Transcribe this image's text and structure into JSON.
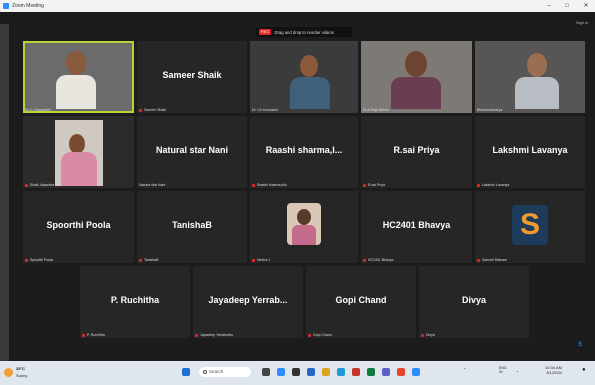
{
  "window": {
    "title": "Zoom Meeting",
    "minimize": "–",
    "maximize": "□",
    "close": "✕"
  },
  "banner": {
    "tag": "REC",
    "message": "Drag and drop to reorder videos"
  },
  "signin": "Sign in",
  "participants": [
    {
      "name": "",
      "label": "Dr.V. Dhayanidhi",
      "video": true,
      "active": true
    },
    {
      "name": "Sameer Shaik",
      "label": "Sameer Shaik",
      "video": false
    },
    {
      "name": "",
      "label": "Dr. Ch Kondaiah",
      "video": true
    },
    {
      "name": "",
      "label": "Dr.A Raja Sekha",
      "video": true
    },
    {
      "name": "",
      "label": "Bhaskaracharya",
      "video": true
    },
    {
      "name": "",
      "label": "Shaik Vasantha",
      "video": true
    },
    {
      "name": "Natural star Nani",
      "label": "Natural star Nani",
      "video": false
    },
    {
      "name": "Raashi  sharma,l...",
      "label": "Raashi sharma,ello",
      "video": false
    },
    {
      "name": "R.sai Priya",
      "label": "R.sai Priya",
      "video": false
    },
    {
      "name": "Lakshmi Lavanya",
      "label": "Lakshmi Lavanya",
      "video": false
    },
    {
      "name": "Spoorthi Poola",
      "label": "Spoorthi Poola",
      "video": false
    },
    {
      "name": "TanishaB",
      "label": "TanishaB",
      "video": false
    },
    {
      "name": "",
      "label": "Neeha J",
      "video": true
    },
    {
      "name": "HC2401 Bhavya",
      "label": "HC2401 Bhavya",
      "video": false
    },
    {
      "name": "",
      "label": "Samuel Ratnam",
      "video": false,
      "logo": "S"
    },
    {
      "name": "P. Ruchitha",
      "label": "P. Ruchitha",
      "video": false
    },
    {
      "name": "Jayadeep  Yerrab...",
      "label": "Jayadeep Yerrabothu",
      "video": false
    },
    {
      "name": "Gopi Chand",
      "label": "Gopi Chand",
      "video": false
    },
    {
      "name": "Divya",
      "label": "Divya",
      "video": false
    }
  ],
  "taskbar": {
    "weather_temp": "33°C",
    "weather_desc": "Sunny",
    "search_placeholder": "Search",
    "lang": "ENG",
    "lang2": "IN",
    "time": "10:34 AM",
    "date": "3/1/2024"
  },
  "colors": {
    "active_border": "#b7d334",
    "muted_mic": "#e02828",
    "tile_bg": "#262626"
  }
}
